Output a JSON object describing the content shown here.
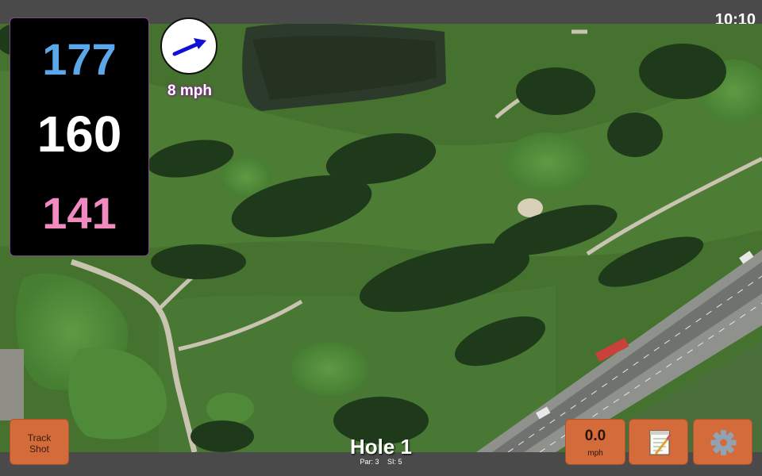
{
  "status_bar": {
    "time": "10:10"
  },
  "distances": {
    "back": "177",
    "center": "160",
    "front": "141"
  },
  "wind": {
    "speed_label": "8 mph",
    "direction_icon": "wind-arrow-icon"
  },
  "hole": {
    "title": "Hole 1",
    "par_label": "Par: 3",
    "si_label": "SI: 5"
  },
  "buttons": {
    "track_shot_line1": "Track",
    "track_shot_line2": "Shot",
    "speed_value": "0.0",
    "speed_unit": "mph",
    "notes_icon": "notepad-icon",
    "settings_icon": "gear-icon"
  },
  "colors": {
    "back_distance": "#5aa7ea",
    "center_distance": "#ffffff",
    "front_distance": "#f08ac0",
    "button_bg": "#d36b3a"
  }
}
